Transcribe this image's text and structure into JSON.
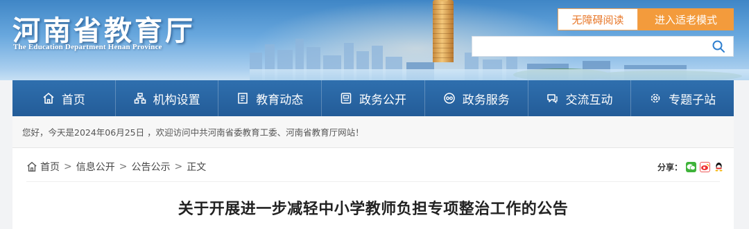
{
  "header": {
    "title": "河南省教育厅",
    "subtitle": "The Education Department Henan Province",
    "accessible_label": "无障碍阅读",
    "elderly_mode_label": "进入适老模式",
    "search_placeholder": ""
  },
  "nav": {
    "items": [
      {
        "label": "首页",
        "icon": "home-icon"
      },
      {
        "label": "机构设置",
        "icon": "org-icon"
      },
      {
        "label": "教育动态",
        "icon": "news-icon"
      },
      {
        "label": "政务公开",
        "icon": "document-icon"
      },
      {
        "label": "政务服务",
        "icon": "service-icon"
      },
      {
        "label": "交流互动",
        "icon": "chat-icon"
      },
      {
        "label": "专题子站",
        "icon": "gear-icon"
      }
    ]
  },
  "welcome": {
    "text": "您好，今天是2024年06月25日 ，欢迎访问中共河南省委教育工委、河南省教育厅网站！"
  },
  "breadcrumb": {
    "items": [
      "首页",
      "信息公开",
      "公告公示",
      "正文"
    ],
    "separator": ">"
  },
  "share": {
    "label": "分享：",
    "icons": [
      "wechat-icon",
      "weibo-icon",
      "qq-icon"
    ]
  },
  "article": {
    "title": "关于开展进一步减轻中小学教师负担专项整治工作的公告"
  },
  "colors": {
    "nav_bg": "#2a66a5",
    "accent_orange": "#f39b3c",
    "banner_sky": "#5d9fd8"
  }
}
